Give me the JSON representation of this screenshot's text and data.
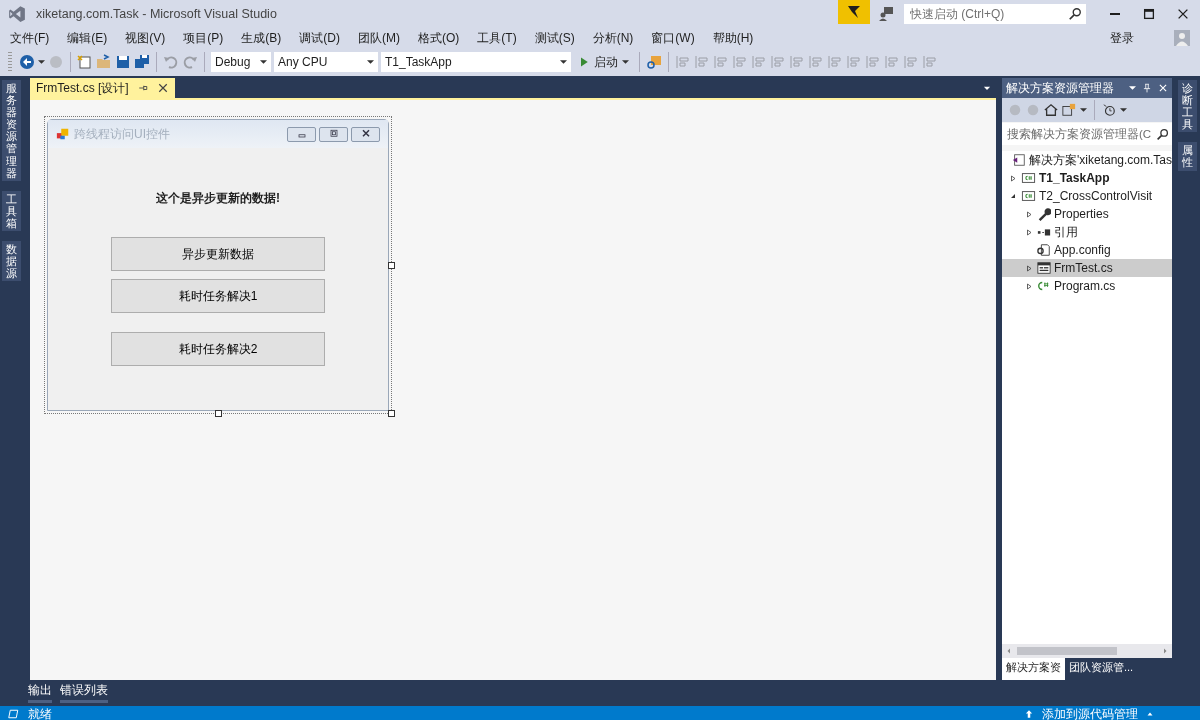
{
  "window": {
    "title": "xiketang.com.Task - Microsoft Visual Studio"
  },
  "quick_launch": {
    "placeholder": "快速启动 (Ctrl+Q)"
  },
  "menu": [
    "文件(F)",
    "编辑(E)",
    "视图(V)",
    "项目(P)",
    "生成(B)",
    "调试(D)",
    "团队(M)",
    "格式(O)",
    "工具(T)",
    "测试(S)",
    "分析(N)",
    "窗口(W)",
    "帮助(H)"
  ],
  "sign_in": "登录",
  "toolbar": {
    "configuration": "Debug",
    "platform": "Any CPU",
    "startup_project": "T1_TaskApp",
    "start_button": "启动"
  },
  "left_strip": [
    {
      "label": "服务器资源管理器"
    },
    {
      "label": "工具箱"
    },
    {
      "label": "数据源"
    }
  ],
  "document_tabs": [
    {
      "label": "FrmTest.cs [设计]",
      "selected": true
    }
  ],
  "form": {
    "title": "跨线程访问UI控件",
    "label": "这个是异步更新的数据!",
    "buttons": [
      "异步更新数据",
      "耗时任务解决1",
      "耗时任务解决2"
    ]
  },
  "solution_explorer": {
    "title": "解决方案资源管理器",
    "search": {
      "placeholder": "搜索解决方案资源管理器(C"
    },
    "tree": [
      {
        "label": "解决方案'xiketang.com.Tas",
        "kind": "solution",
        "selected": false,
        "children": [
          {
            "label": "T1_TaskApp",
            "kind": "project",
            "startup": true,
            "expanded": false,
            "selected": false
          },
          {
            "label": "T2_CrossControlVisit",
            "kind": "project",
            "startup": false,
            "expanded": true,
            "selected": false,
            "children": [
              {
                "label": "Properties",
                "kind": "properties",
                "expanded": false,
                "selected": false
              },
              {
                "label": "引用",
                "kind": "references",
                "expanded": false,
                "selected": false
              },
              {
                "label": "App.config",
                "kind": "config",
                "selected": false
              },
              {
                "label": "FrmTest.cs",
                "kind": "form",
                "expanded": false,
                "selected": true
              },
              {
                "label": "Program.cs",
                "kind": "csharp",
                "expanded": false,
                "selected": false
              }
            ]
          }
        ]
      }
    ],
    "tabs": [
      {
        "label": "解决方案资",
        "selected": true
      },
      {
        "label": "团队资源管...",
        "selected": false
      }
    ]
  },
  "right_strip": [
    {
      "label": "诊断工具"
    },
    {
      "label": "属性"
    }
  ],
  "bottom_tabs": [
    {
      "label": "输出"
    },
    {
      "label": "错误列表"
    }
  ],
  "status_bar": {
    "text": "就绪",
    "source_control": "添加到源代码管理"
  }
}
